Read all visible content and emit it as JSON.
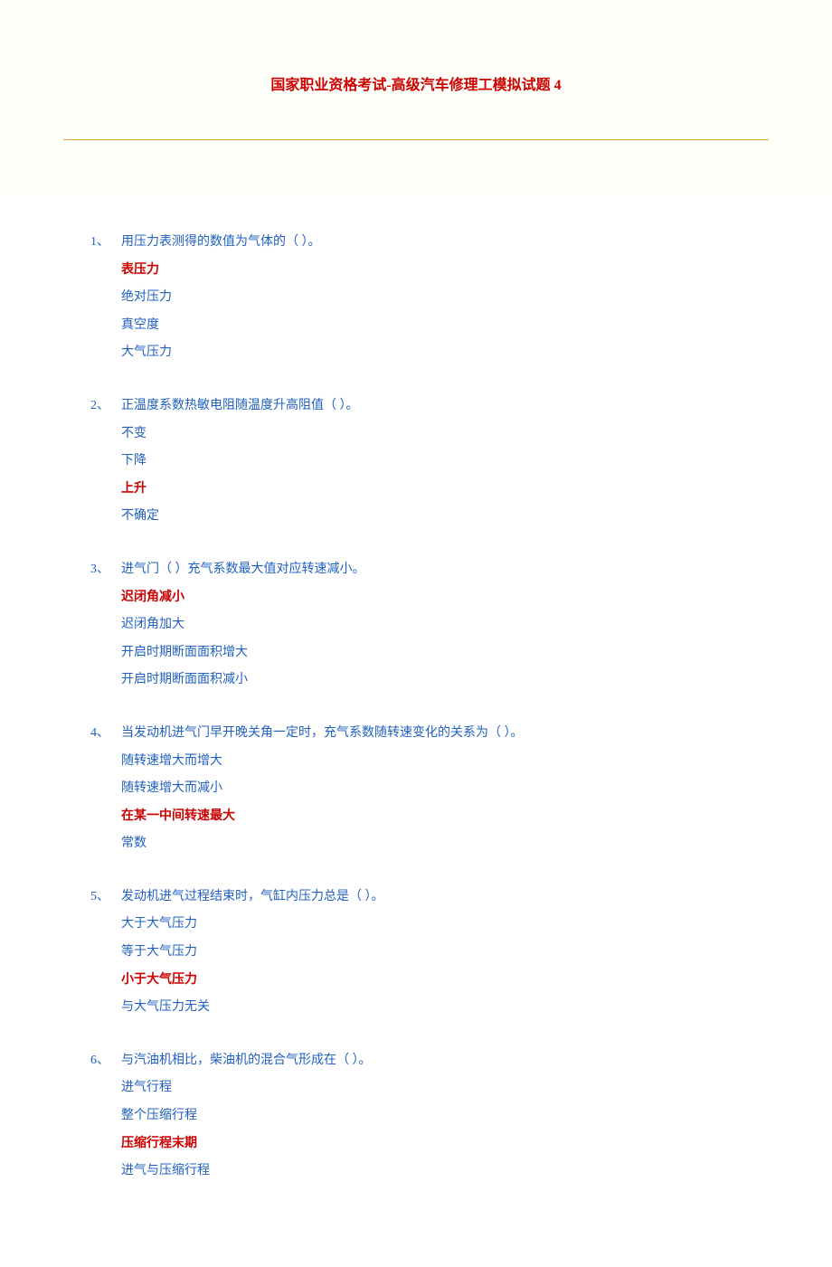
{
  "title": "国家职业资格考试-高级汽车修理工模拟试题 4",
  "questions": [
    {
      "num": "1、",
      "text": "用压力表测得的数值为气体的（ ）。",
      "options": [
        {
          "text": "表压力",
          "correct": true
        },
        {
          "text": "绝对压力",
          "correct": false
        },
        {
          "text": "真空度",
          "correct": false
        },
        {
          "text": "大气压力",
          "correct": false
        }
      ]
    },
    {
      "num": "2、",
      "text": "正温度系数热敏电阻随温度升高阻值（ ）。",
      "options": [
        {
          "text": "不变",
          "correct": false
        },
        {
          "text": "下降",
          "correct": false
        },
        {
          "text": "上升",
          "correct": true
        },
        {
          "text": "不确定",
          "correct": false
        }
      ]
    },
    {
      "num": "3、",
      "text": "进气门（ ）充气系数最大值对应转速减小。",
      "options": [
        {
          "text": "迟闭角减小",
          "correct": true
        },
        {
          "text": "迟闭角加大",
          "correct": false
        },
        {
          "text": "开启时期断面面积增大",
          "correct": false
        },
        {
          "text": "开启时期断面面积减小",
          "correct": false
        }
      ]
    },
    {
      "num": "4、",
      "text": "当发动机进气门早开晚关角一定时，充气系数随转速变化的关系为（ ）。",
      "options": [
        {
          "text": "随转速增大而增大",
          "correct": false
        },
        {
          "text": "随转速增大而减小",
          "correct": false
        },
        {
          "text": "在某一中间转速最大",
          "correct": true
        },
        {
          "text": "常数",
          "correct": false
        }
      ]
    },
    {
      "num": "5、",
      "text": "发动机进气过程结束时，气缸内压力总是（ ）。",
      "options": [
        {
          "text": "大于大气压力",
          "correct": false
        },
        {
          "text": "等于大气压力",
          "correct": false
        },
        {
          "text": "小于大气压力",
          "correct": true
        },
        {
          "text": "与大气压力无关",
          "correct": false
        }
      ]
    },
    {
      "num": "6、",
      "text": "与汽油机相比，柴油机的混合气形成在（ ）。",
      "options": [
        {
          "text": "进气行程",
          "correct": false
        },
        {
          "text": "整个压缩行程",
          "correct": false
        },
        {
          "text": "压缩行程末期",
          "correct": true
        },
        {
          "text": "进气与压缩行程",
          "correct": false
        }
      ]
    }
  ]
}
